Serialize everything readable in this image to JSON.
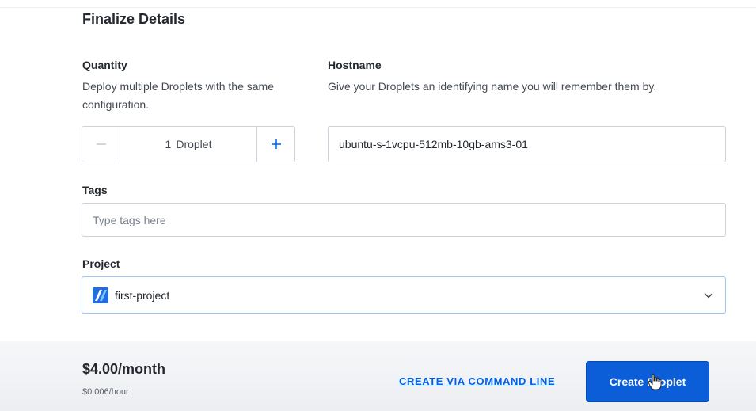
{
  "section": {
    "title": "Finalize Details"
  },
  "quantity": {
    "label": "Quantity",
    "help": "Deploy multiple Droplets with the same configuration.",
    "count": "1",
    "unit": "Droplet",
    "decrement_icon": "minus-icon",
    "increment_icon": "plus-icon"
  },
  "hostname": {
    "label": "Hostname",
    "help": "Give your Droplets an identifying name you will remember them by.",
    "value": "ubuntu-s-1vcpu-512mb-10gb-ams3-01"
  },
  "tags": {
    "label": "Tags",
    "placeholder": "Type tags here"
  },
  "project": {
    "label": "Project",
    "selected": "first-project",
    "icon": "project-icon",
    "dropdown_icon": "chevron-down-icon"
  },
  "footer": {
    "price": "$4.00/month",
    "hourly": "$0.006/hour",
    "cli_link": "CREATE VIA COMMAND LINE",
    "create_button": "Create Droplet"
  },
  "colors": {
    "accent": "#0069ff",
    "primary_button": "#0b5ed7",
    "text": "#24282e"
  }
}
